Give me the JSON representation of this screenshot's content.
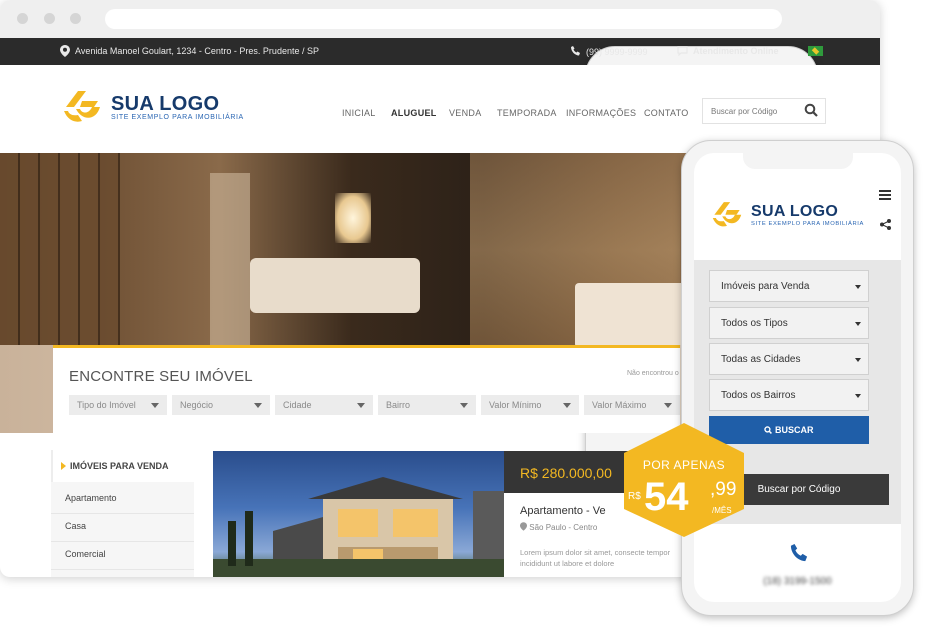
{
  "topbar": {
    "address": "Avenida Manoel Goulart, 1234 - Centro - Pres. Prudente / SP",
    "phone": "(99) 9999-9999",
    "chat": "Atendimento Online"
  },
  "logo": {
    "name": "SUA LOGO",
    "tagline": "SITE EXEMPLO PARA IMOBILIÁRIA"
  },
  "nav": {
    "items": [
      "INICIAL",
      "ALUGUEL",
      "VENDA",
      "TEMPORADA",
      "INFORMAÇÕES",
      "CONTATO"
    ],
    "active": "ALUGUEL",
    "search_placeholder": "Buscar por Código"
  },
  "finder": {
    "title": "ENCONTRE SEU IMÓVEL",
    "note": "Não encontrou o",
    "filters": [
      "Tipo do Imóvel",
      "Negócio",
      "Cidade",
      "Bairro",
      "Valor Mínimo",
      "Valor Máximo"
    ]
  },
  "sidebar": {
    "heading": "IMÓVEIS PARA VENDA",
    "items": [
      "Apartamento",
      "Casa",
      "Comercial"
    ]
  },
  "listing": {
    "price": "R$ 280.000,00",
    "title": "Apartamento - Ve",
    "location": "São Paulo - Centro",
    "description": "Lorem ipsum dolor sit amet, consecte tempor incididunt ut labore et dolore"
  },
  "badge": {
    "line1": "POR APENAS",
    "currency": "R$",
    "integer": "54",
    "cents": ",99",
    "period": "/MÊS",
    "color": "#f3b822"
  },
  "mobile": {
    "selects": [
      "Imóveis para Venda",
      "Todos os Tipos",
      "Todas as Cidades",
      "Todos os Bairros"
    ],
    "search_button": "BUSCAR",
    "code_button": "Buscar por Código",
    "phone": "(18) 3199-1500"
  },
  "colors": {
    "accent": "#f3b822",
    "brand": "#163a6b",
    "button": "#1f5ea8",
    "topbar": "#2b2b2b"
  }
}
